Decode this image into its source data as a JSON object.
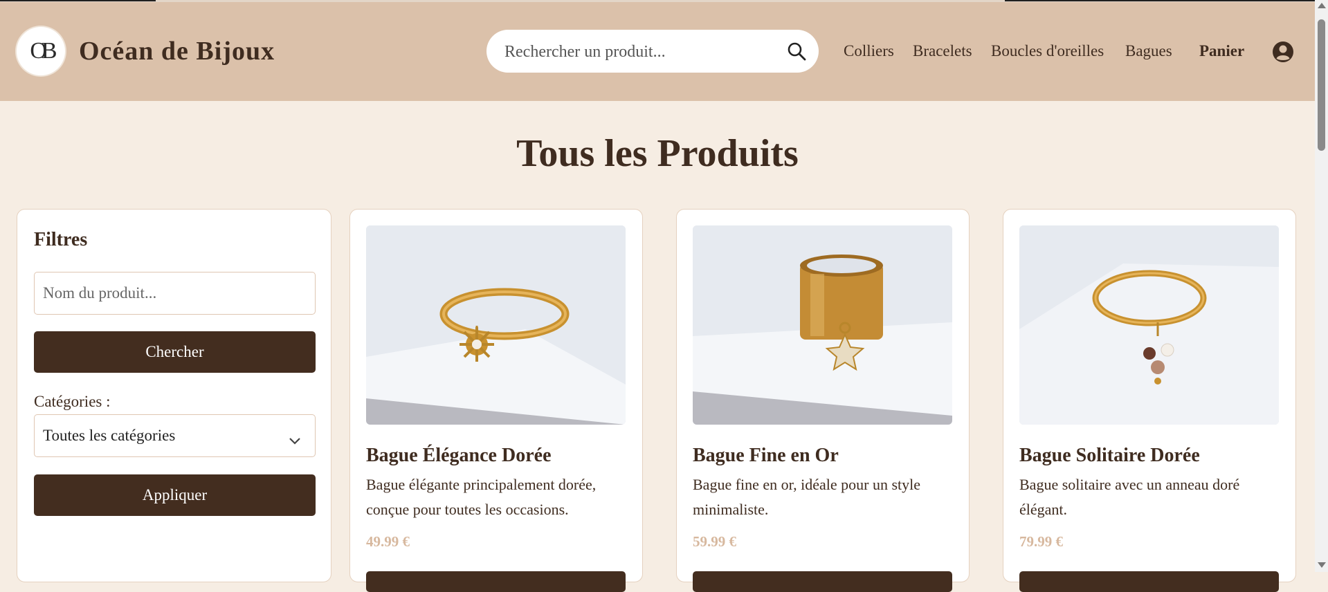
{
  "brand": {
    "name": "Océan de Bijoux",
    "logo_text": "OB"
  },
  "search": {
    "placeholder": "Rechercher un produit..."
  },
  "nav": {
    "items": [
      "Colliers",
      "Bracelets",
      "Boucles d'oreilles",
      "Bagues"
    ],
    "cart": "Panier"
  },
  "page": {
    "title": "Tous les Produits"
  },
  "filters": {
    "title": "Filtres",
    "name_placeholder": "Nom du produit...",
    "search_button": "Chercher",
    "category_label": "Catégories :",
    "category_selected": "Toutes les catégories",
    "apply_button": "Appliquer"
  },
  "products": [
    {
      "name": "Bague Élégance Dorée",
      "description": "Bague élégante principalement dorée, conçue pour toutes les occasions.",
      "price": "49.99 €"
    },
    {
      "name": "Bague Fine en Or",
      "description": "Bague fine en or, idéale pour un style minimaliste.",
      "price": "59.99 €"
    },
    {
      "name": "Bague Solitaire Dorée",
      "description": "Bague solitaire avec un anneau doré élégant.",
      "price": "79.99 €"
    }
  ],
  "colors": {
    "header_bg": "#dbc1aa",
    "page_bg": "#f6ede3",
    "primary": "#432d1f",
    "price": "#d7b89e"
  },
  "icons": {
    "search": "magnifier",
    "account": "user-circle",
    "dropdown": "chevron-down"
  }
}
